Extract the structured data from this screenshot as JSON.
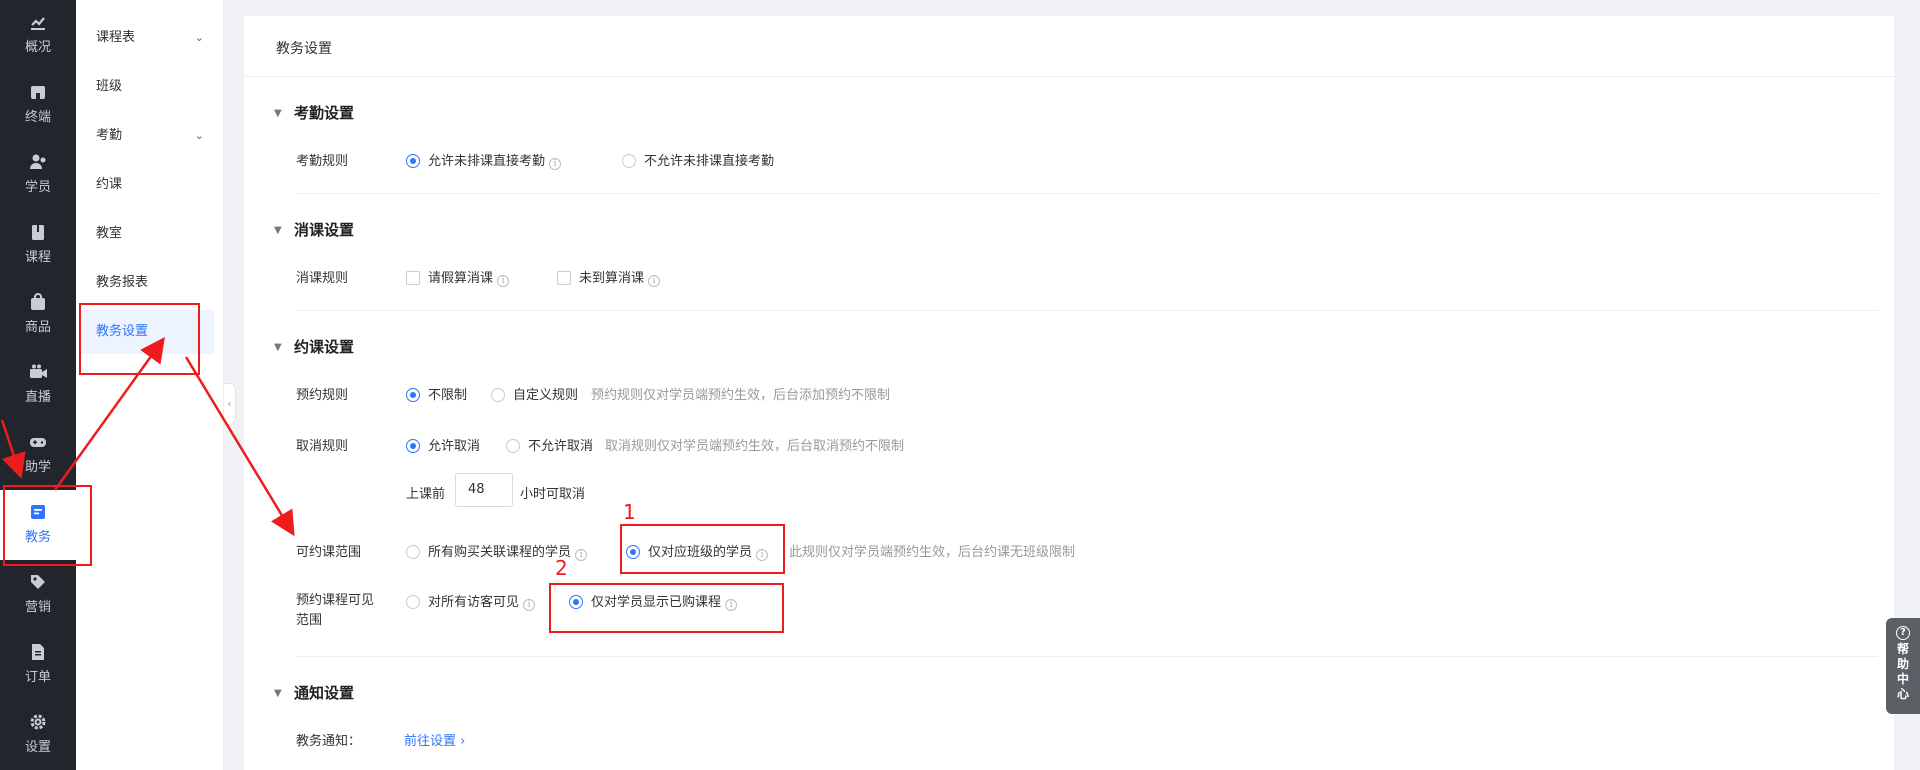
{
  "nav": {
    "items": [
      {
        "label": "概况",
        "icon": "chart-trend-icon"
      },
      {
        "label": "终端",
        "icon": "storefront-icon"
      },
      {
        "label": "学员",
        "icon": "users-icon"
      },
      {
        "label": "课程",
        "icon": "book-icon"
      },
      {
        "label": "商品",
        "icon": "bag-icon"
      },
      {
        "label": "直播",
        "icon": "video-camera-icon"
      },
      {
        "label": "助学",
        "icon": "gamepad-icon"
      },
      {
        "label": "教务",
        "icon": "notebook-icon"
      },
      {
        "label": "营销",
        "icon": "tag-icon"
      },
      {
        "label": "订单",
        "icon": "document-icon"
      },
      {
        "label": "设置",
        "icon": "gear-icon"
      }
    ],
    "active": "教务"
  },
  "submenu": {
    "items": [
      "课程表",
      "班级",
      "考勤",
      "约课",
      "教室",
      "教务报表",
      "教务设置"
    ],
    "active": "教务设置"
  },
  "page": {
    "title": "教务设置"
  },
  "attendance": {
    "title": "考勤设置",
    "rule_label": "考勤规则",
    "opt1": "允许未排课直接考勤",
    "opt2": "不允许未排课直接考勤"
  },
  "consume": {
    "title": "消课设置",
    "rule_label": "消课规则",
    "opt1": "请假算消课",
    "opt2": "未到算消课"
  },
  "booking": {
    "title": "约课设置",
    "rule_label": "预约规则",
    "rule_opt1": "不限制",
    "rule_opt2": "自定义规则",
    "rule_hint": "预约规则仅对学员端预约生效，后台添加预约不限制",
    "cancel_label": "取消规则",
    "cancel_opt1": "允许取消",
    "cancel_opt2": "不允许取消",
    "cancel_hint": "取消规则仅对学员端预约生效，后台取消预约不限制",
    "before_label": "上课前",
    "hours_value": "48",
    "hours_suffix": "小时可取消",
    "scope_label": "可约课范围",
    "scope_opt1": "所有购买关联课程的学员",
    "scope_opt2": "仅对应班级的学员",
    "scope_hint": "此规则仅对学员端预约生效，后台约课无班级限制",
    "visible_label_line1": "预约课程可见",
    "visible_label_line2": "范围",
    "visible_opt1": "对所有访客可见",
    "visible_opt2": "仅对学员显示已购课程"
  },
  "notify": {
    "title": "通知设置",
    "label": "教务通知：",
    "link": "前往设置"
  },
  "annotations": {
    "num1": "1",
    "num2": "2"
  },
  "help": {
    "chars": [
      "帮",
      "助",
      "中",
      "心"
    ]
  },
  "colors": {
    "accent": "#2f74ff",
    "nav_bg": "#22252c",
    "annotation": "#ee1c1c"
  }
}
